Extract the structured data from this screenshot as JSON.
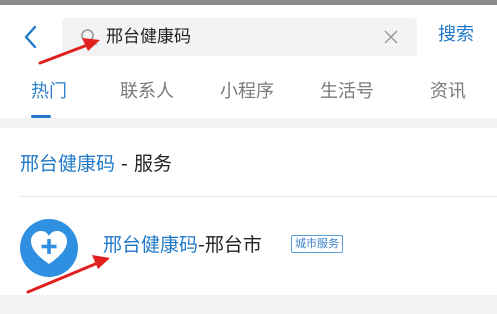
{
  "search": {
    "query": "邢台健康码",
    "submit_label": "搜索"
  },
  "tabs": [
    {
      "label": "热门",
      "active": true
    },
    {
      "label": "联系人",
      "active": false
    },
    {
      "label": "小程序",
      "active": false
    },
    {
      "label": "生活号",
      "active": false
    },
    {
      "label": "资讯",
      "active": false
    }
  ],
  "section": {
    "highlight": "邢台健康码",
    "suffix": " - 服务"
  },
  "result": {
    "title_highlight": "邢台健康码",
    "title_suffix": "-邢台市",
    "badge": "城市服务",
    "icon": "heart-plus-icon"
  },
  "colors": {
    "accent": "#1f78c8",
    "arrow": "#e0201e",
    "icon_bg": "#2f8fe0"
  }
}
